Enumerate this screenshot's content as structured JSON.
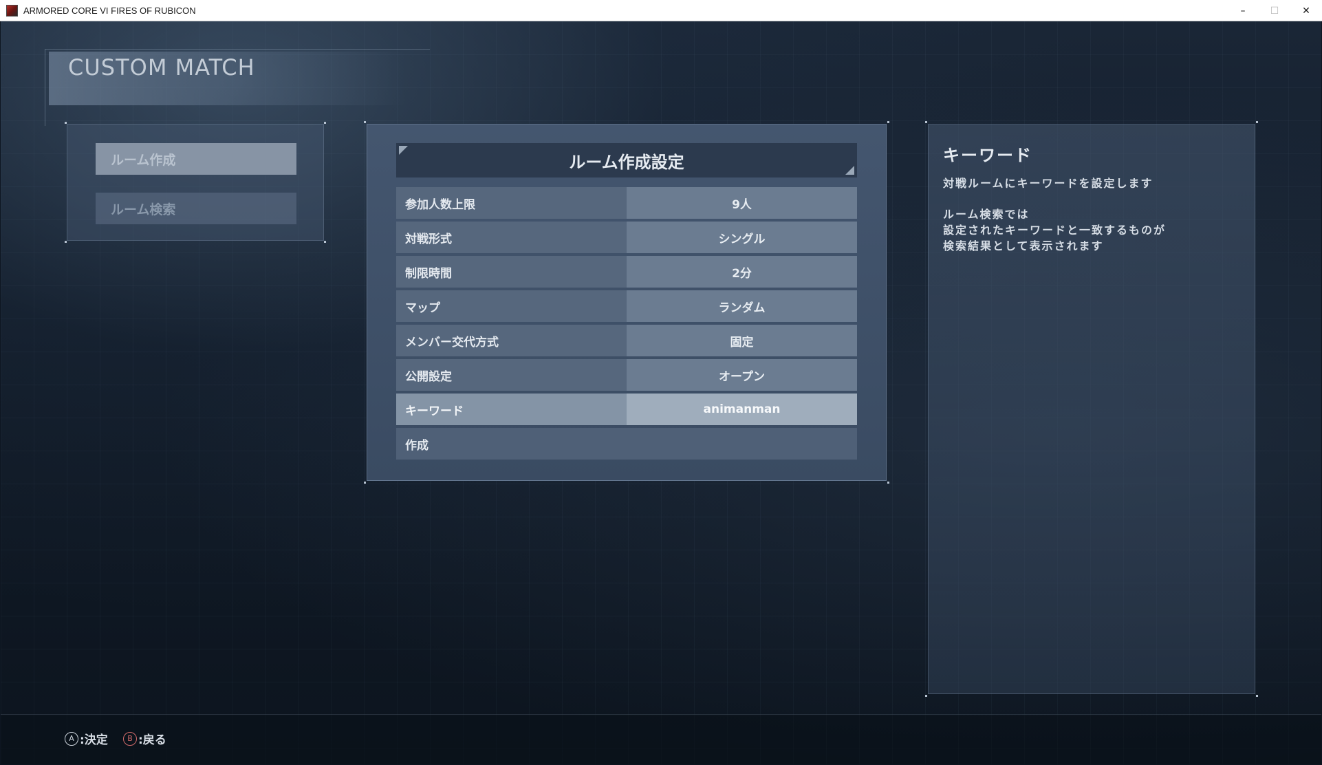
{
  "window": {
    "title": "ARMORED CORE VI FIRES OF RUBICON",
    "minimize_glyph": "–",
    "maximize_glyph": "☐",
    "close_glyph": "✕"
  },
  "page": {
    "title": "CUSTOM MATCH"
  },
  "left_menu": {
    "items": [
      {
        "label": "ルーム作成",
        "active": true
      },
      {
        "label": "ルーム検索",
        "active": false
      }
    ]
  },
  "settings": {
    "header": "ルーム作成設定",
    "rows": [
      {
        "label": "参加人数上限",
        "value": "9人"
      },
      {
        "label": "対戦形式",
        "value": "シングル"
      },
      {
        "label": "制限時間",
        "value": "2分"
      },
      {
        "label": "マップ",
        "value": "ランダム"
      },
      {
        "label": "メンバー交代方式",
        "value": "固定"
      },
      {
        "label": "公開設定",
        "value": "オープン"
      },
      {
        "label": "キーワード",
        "value": "animanman",
        "selected": true
      }
    ],
    "create_label": "作成"
  },
  "description": {
    "title": "キーワード",
    "line1": "対戦ルームにキーワードを設定します",
    "line2": "ルーム検索では",
    "line3": "設定されたキーワードと一致するものが",
    "line4": "検索結果として表示されます"
  },
  "footer": {
    "confirm_glyph": "A",
    "confirm_label": ":決定",
    "back_glyph": "B",
    "back_label": ":戻る"
  },
  "colors": {
    "selected_row": "#8494a6",
    "back_button": "#d16a6a"
  }
}
